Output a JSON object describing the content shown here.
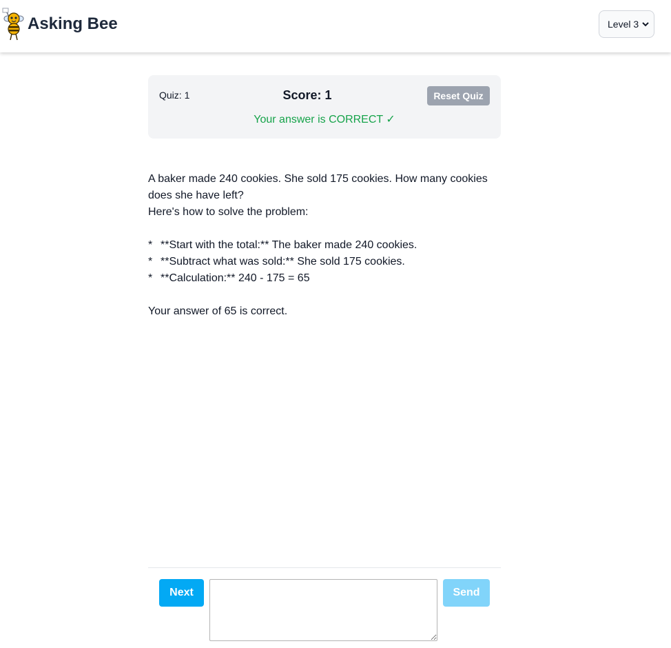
{
  "header": {
    "app_title": "Asking Bee",
    "logo_icon": "bee-mascot-icon",
    "level_select": {
      "selected": "Level 3",
      "icon": "chevron-down-icon"
    }
  },
  "quiz_panel": {
    "quiz_count": "Quiz: 1",
    "score": "Score: 1",
    "reset_label": "Reset Quiz",
    "feedback": "Your answer is CORRECT ✓",
    "feedback_color": "#16a34a",
    "reset_color": "#9ca3af"
  },
  "content": {
    "question": "A baker made 240 cookies. She sold 175 cookies. How many cookies does she have left?",
    "intro": "Here's how to solve the problem:",
    "bullets": [
      {
        "mark": "*",
        "text": "**Start with the total:** The baker made 240 cookies."
      },
      {
        "mark": "*",
        "text": "**Subtract what was sold:** She sold 175 cookies."
      },
      {
        "mark": "*",
        "text": "**Calculation:** 240 - 175 = 65"
      }
    ],
    "conclusion": "Your answer of 65 is correct."
  },
  "footer": {
    "next_label": "Next",
    "send_label": "Send",
    "answer_value": "",
    "next_color": "#03a9f4",
    "send_color": "#81d4fa"
  }
}
